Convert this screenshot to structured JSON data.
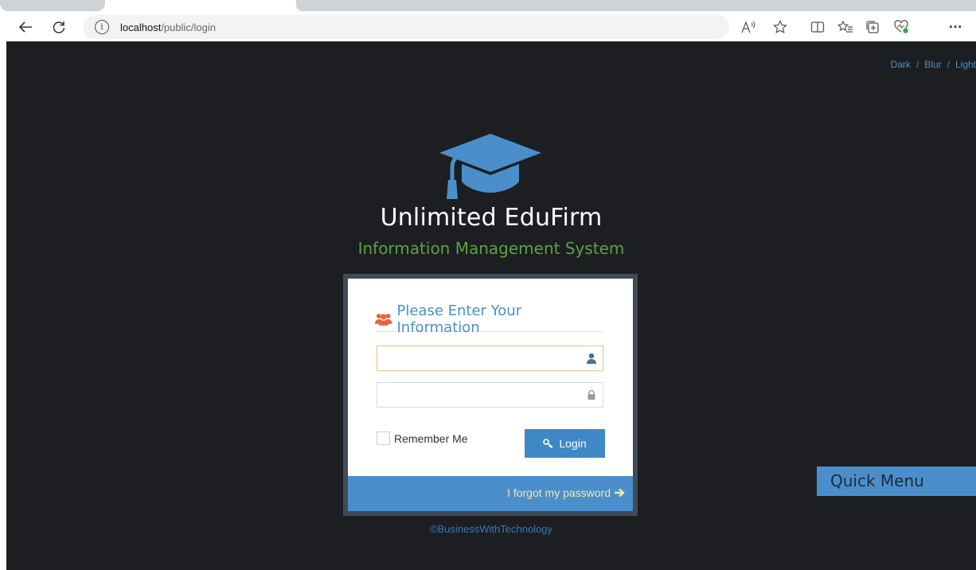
{
  "browser": {
    "url_host": "localhost",
    "url_path": "/public/login",
    "info_icon_glyph": "i",
    "nav_icons": [
      "back-arrow-icon",
      "refresh-icon"
    ],
    "toolbar_icons": [
      "read-aloud-icon",
      "favorite-star-icon",
      "split-screen-icon",
      "favorites-list-icon",
      "collections-icon",
      "browser-essentials-icon",
      "more-menu-icon"
    ],
    "more_glyph": "···"
  },
  "theme_switch": {
    "dark": "Dark",
    "blur": "Blur",
    "light": "Light",
    "separator": "/"
  },
  "app": {
    "title": "Unlimited EduFirm",
    "subtitle": "Information Management System"
  },
  "login": {
    "heading": "Please Enter Your Information",
    "username_value": "",
    "password_value": "",
    "remember_label": "Remember Me",
    "remember_checked": false,
    "button_label": "Login",
    "forgot_label": "I forgot my password"
  },
  "footer": {
    "copyright": "©BusinessWithTechnology"
  },
  "quick_menu": {
    "label": "Quick Menu"
  },
  "colors": {
    "page_bg": "#1c1e22",
    "accent_blue": "#4a8fcb",
    "subtitle_green": "#5aa33f",
    "users_icon_orange": "#e8643a",
    "forgot_text": "#f3e6a8"
  }
}
